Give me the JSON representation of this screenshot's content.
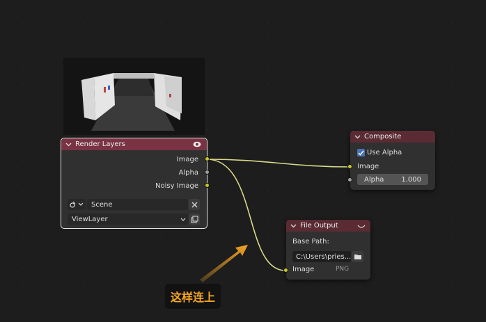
{
  "render_layers": {
    "title": "Render Layers",
    "outputs": [
      "Image",
      "Alpha",
      "Noisy Image"
    ],
    "scene_value": "Scene",
    "view_layer_value": "ViewLayer"
  },
  "composite": {
    "title": "Composite",
    "use_alpha_label": "Use Alpha",
    "use_alpha_checked": true,
    "input_image_label": "Image",
    "alpha_label": "Alpha",
    "alpha_value": "1.000"
  },
  "file_output": {
    "title": "File Output",
    "base_path_label": "Base Path:",
    "base_path_value": "C:\\Users\\pries...",
    "input_image_label": "Image",
    "format_label": "PNG"
  },
  "annotation": {
    "text": "这样连上"
  },
  "colors": {
    "render_layers_header": "#7a3343",
    "output_node_header": "#5a2b33",
    "link_color": "#d9d98c",
    "socket_color": "#c7c729",
    "arrow_color": "#f5a623"
  }
}
